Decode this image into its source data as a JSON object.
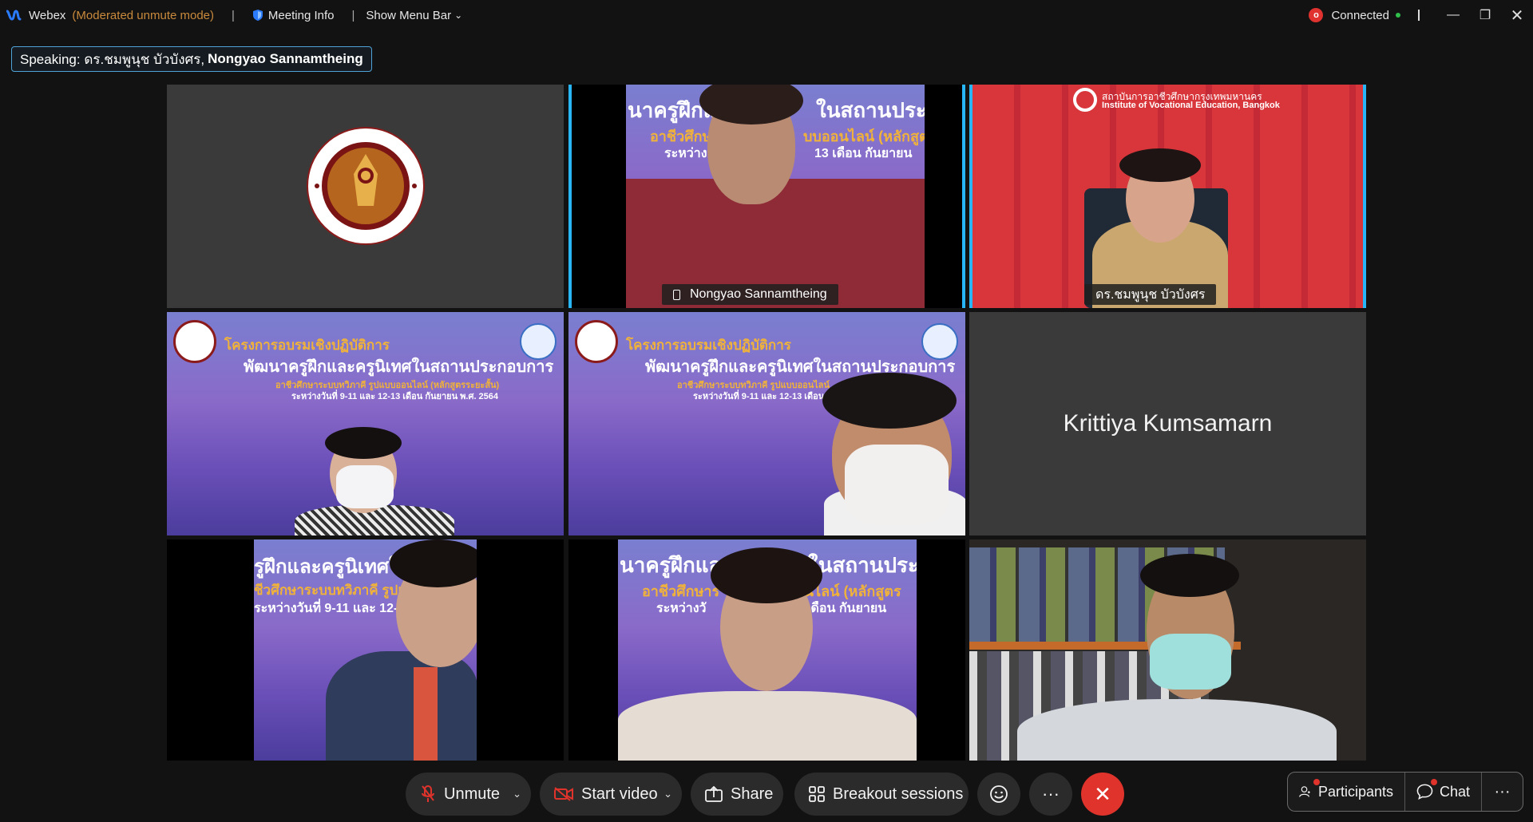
{
  "topbar": {
    "app_name": "Webex",
    "mode": "(Moderated unmute mode)",
    "meeting_info": "Meeting Info",
    "show_menu_bar": "Show Menu Bar",
    "recording_indicator": "o",
    "connection_status": "Connected"
  },
  "speaking": {
    "prefix": "Speaking: ดร.ชมพูนุช บัวบังศร,",
    "bold": "Nongyao Sannamtheing"
  },
  "tiles": [
    {
      "name": "",
      "type": "logo"
    },
    {
      "name": "Nongyao Sannamtheing",
      "type": "video",
      "active": true,
      "banner": [
        "นาครูฝึกแ",
        "ในสถานประก",
        "อาชีวศึกษ",
        "บบออนไลน์ (หลักสูตร",
        "ระหว่างวั",
        "13 เดือน กันยายน"
      ]
    },
    {
      "name": "ดร.ชมพูนุช บัวบังศร",
      "type": "video",
      "active": true,
      "backdrop": [
        "สถาบันการอาชีวศึกษากรุงเทพมหานคร",
        "Institute of Vocational Education, Bangkok"
      ]
    },
    {
      "name": "",
      "type": "video",
      "banner": [
        "โครงการอบรมเชิงปฏิบัติการ",
        "พัฒนาครูฝึกและครูนิเทศในสถานประกอบการ",
        "อาชีวศึกษาระบบทวิภาคี รูปแบบออนไลน์ (หลักสูตรระยะสั้น)",
        "ระหว่างวันที่ 9-11 และ 12-13 เดือน กันยายน พ.ศ. 2564"
      ]
    },
    {
      "name": "",
      "type": "video",
      "banner": [
        "โครงการอบรมเชิงปฏิบัติการ",
        "พัฒนาครูฝึกและครูนิเทศในสถานประกอบการ",
        "อาชีวศึกษาระบบทวิภาคี รูปแบบออนไลน์",
        "ระหว่างวันที่ 9-11 และ 12-13 เดือน"
      ]
    },
    {
      "name": "Krittiya Kumsamarn",
      "type": "name-only"
    },
    {
      "name": "",
      "type": "video",
      "banner": [
        "รูฝึกและครูนิเทศใ",
        "ชีวศึกษาระบบทวิภาคี รูปแบ",
        "ระหว่างวันที่ 9-11 และ 12-"
      ]
    },
    {
      "name": "",
      "type": "video",
      "banner": [
        "นาครูฝึกและ",
        "ในสถานประก",
        "อาชีวศึกษาร",
        "อนไลน์ (หลักสูตร",
        "ระหว่างวั",
        "เดือน กันยายน"
      ]
    },
    {
      "name": "",
      "type": "video"
    }
  ],
  "toolbar": {
    "unmute": "Unmute",
    "start_video": "Start video",
    "share": "Share",
    "breakout": "Breakout sessions",
    "more": "···",
    "participants": "Participants",
    "chat": "Chat",
    "side_more": "···"
  },
  "colors": {
    "active_border": "#29b6f6",
    "end_button": "#e0332c",
    "mode_text": "#c98a3c",
    "connected_dot": "#2fbf4a"
  }
}
